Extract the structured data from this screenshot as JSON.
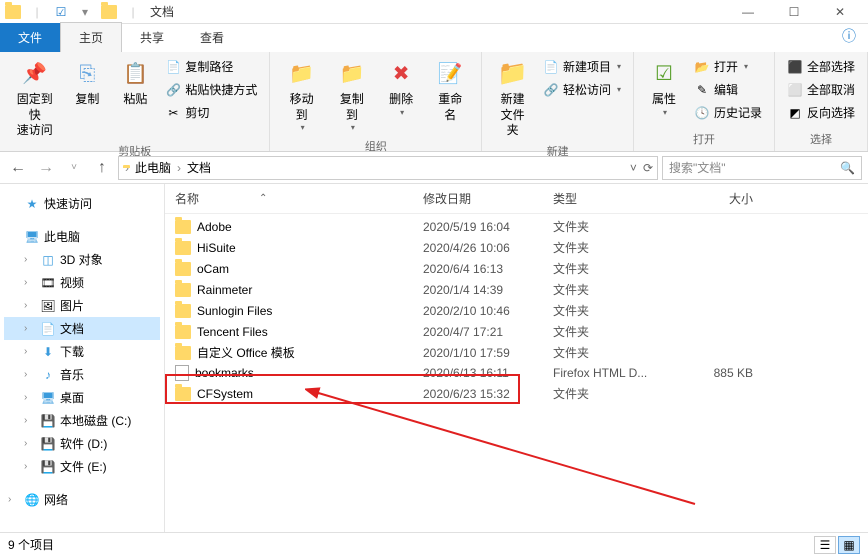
{
  "title": "文档",
  "tabs": {
    "file": "文件",
    "home": "主页",
    "share": "共享",
    "view": "查看"
  },
  "ribbon": {
    "pin": "固定到快\n速访问",
    "copy": "复制",
    "paste": "粘贴",
    "copy_path": "复制路径",
    "paste_shortcut": "粘贴快捷方式",
    "cut": "剪切",
    "clipboard_group": "剪贴板",
    "move_to": "移动到",
    "copy_to": "复制到",
    "delete": "删除",
    "rename": "重命名",
    "organize_group": "组织",
    "new_folder": "新建\n文件夹",
    "new_item": "新建项目",
    "easy_access": "轻松访问",
    "new_group": "新建",
    "properties": "属性",
    "open": "打开",
    "edit": "编辑",
    "history": "历史记录",
    "open_group": "打开",
    "select_all": "全部选择",
    "select_none": "全部取消",
    "invert_selection": "反向选择",
    "select_group": "选择"
  },
  "breadcrumb": {
    "pc": "此电脑",
    "folder": "文档"
  },
  "search_placeholder": "搜索\"文档\"",
  "nav": {
    "quick_access": "快速访问",
    "this_pc": "此电脑",
    "objects_3d": "3D 对象",
    "videos": "视频",
    "pictures": "图片",
    "documents": "文档",
    "downloads": "下载",
    "music": "音乐",
    "desktop": "桌面",
    "disk_c": "本地磁盘 (C:)",
    "disk_d": "软件 (D:)",
    "disk_e": "文件 (E:)",
    "network": "网络"
  },
  "columns": {
    "name": "名称",
    "date": "修改日期",
    "type": "类型",
    "size": "大小"
  },
  "type_folder": "文件夹",
  "files": [
    {
      "name": "Adobe",
      "date": "2020/5/19 16:04",
      "type": "文件夹",
      "size": "",
      "icon": "folder"
    },
    {
      "name": "HiSuite",
      "date": "2020/4/26 10:06",
      "type": "文件夹",
      "size": "",
      "icon": "folder"
    },
    {
      "name": "oCam",
      "date": "2020/6/4 16:13",
      "type": "文件夹",
      "size": "",
      "icon": "folder"
    },
    {
      "name": "Rainmeter",
      "date": "2020/1/4 14:39",
      "type": "文件夹",
      "size": "",
      "icon": "folder"
    },
    {
      "name": "Sunlogin Files",
      "date": "2020/2/10 10:46",
      "type": "文件夹",
      "size": "",
      "icon": "folder"
    },
    {
      "name": "Tencent Files",
      "date": "2020/4/7 17:21",
      "type": "文件夹",
      "size": "",
      "icon": "folder"
    },
    {
      "name": "自定义 Office 模板",
      "date": "2020/1/10 17:59",
      "type": "文件夹",
      "size": "",
      "icon": "folder"
    },
    {
      "name": "bookmarks",
      "date": "2020/6/13 16:11",
      "type": "Firefox HTML D...",
      "size": "885 KB",
      "icon": "file"
    },
    {
      "name": "CFSystem",
      "date": "2020/6/23 15:32",
      "type": "文件夹",
      "size": "",
      "icon": "folder"
    }
  ],
  "status": "9 个项目"
}
